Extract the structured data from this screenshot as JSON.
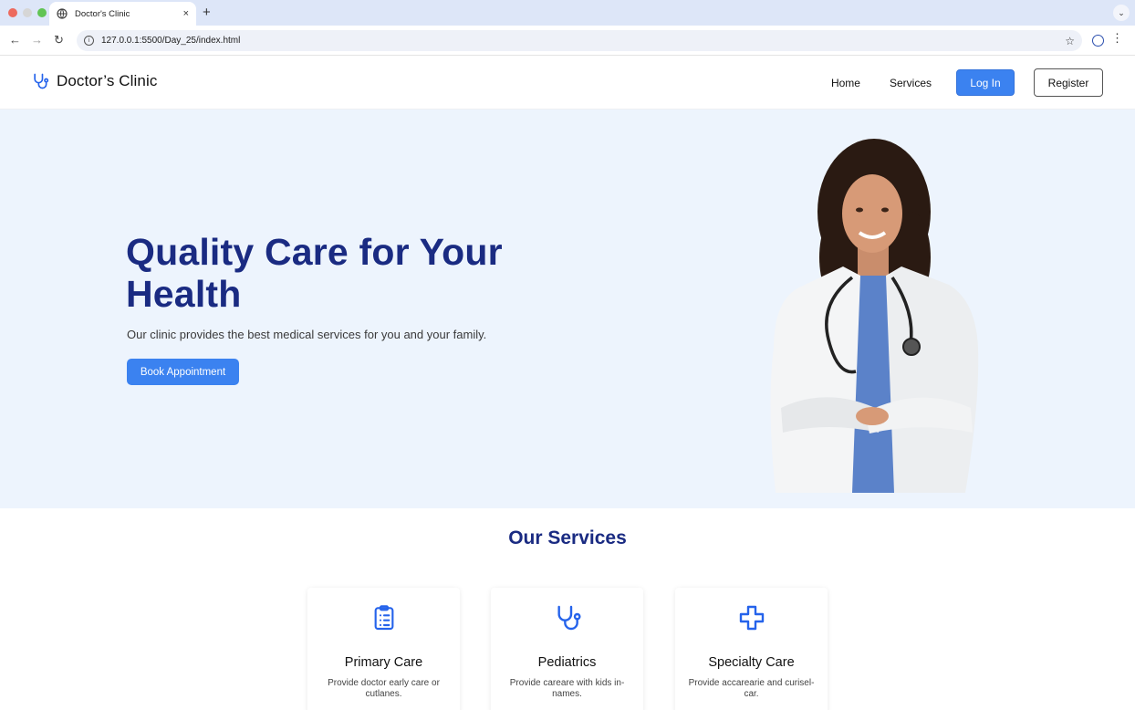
{
  "browser": {
    "tab_title": "Doctor's Clinic",
    "tab_close": "×",
    "new_tab": "+",
    "url": "127.0.0.1:5500/Day_25/index.html",
    "menu_chevron": "⌄",
    "back": "←",
    "forward": "→",
    "reload": "↻",
    "bookmark": "☆",
    "kebab": "⋮",
    "icons": [
      "globe-icon",
      "info-icon",
      "star-icon",
      "profile-icon"
    ]
  },
  "header": {
    "brand": "Doctor’s Clinic",
    "brand_icon": "stethoscope-icon",
    "nav": {
      "home": "Home",
      "services": "Services",
      "login": "Log In",
      "register": "Register"
    }
  },
  "hero": {
    "title": "Quality Care for Your Health",
    "subtitle": "Our clinic provides the best medical services for you and your family.",
    "cta": "Book Appointment"
  },
  "services": {
    "title": "Our Services",
    "cards": [
      {
        "title": "Primary Care",
        "desc": "Provide doctor early care or cutlanes.",
        "icon": "clipboard-icon"
      },
      {
        "title": "Pediatrics",
        "desc": "Provide careare with kids in-names.",
        "icon": "stethoscope-icon"
      },
      {
        "title": "Specialty Care",
        "desc": "Provide accarearie and curisel-car.",
        "icon": "medical-cross-icon"
      }
    ]
  },
  "colors": {
    "accent": "#3b82f0",
    "heading": "#1a2b82",
    "hero_bg": "#edf4fd"
  }
}
